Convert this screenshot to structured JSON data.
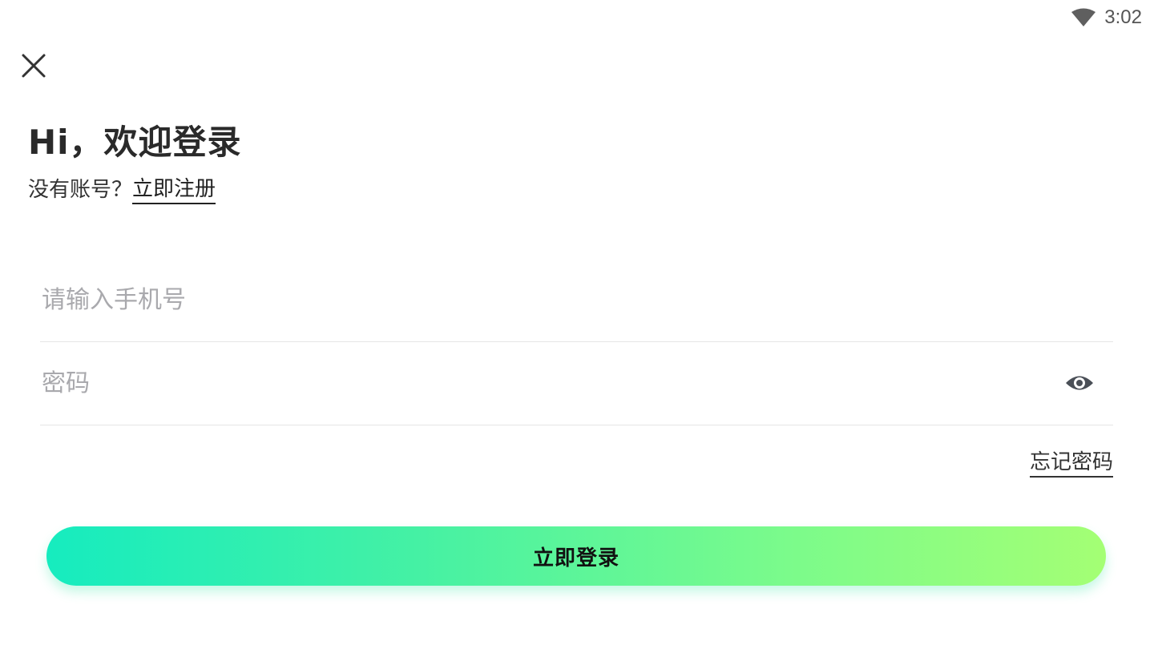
{
  "status_bar": {
    "time": "3:02",
    "wifi_icon": "wifi-icon"
  },
  "header": {
    "close_icon": "close-icon",
    "title": "Hi，欢迎登录"
  },
  "register": {
    "prompt": "没有账号？",
    "link_label": "立即注册"
  },
  "form": {
    "phone": {
      "value": "",
      "placeholder": "请输入手机号"
    },
    "password": {
      "value": "",
      "placeholder": "密码",
      "toggle_icon": "eye-icon"
    },
    "forgot_label": "忘记密码",
    "submit_label": "立即登录"
  },
  "colors": {
    "button_gradient_start": "#16ecbf",
    "button_gradient_end": "#a4ff74",
    "placeholder": "#a9a9ad",
    "title": "#2a2a2a"
  }
}
